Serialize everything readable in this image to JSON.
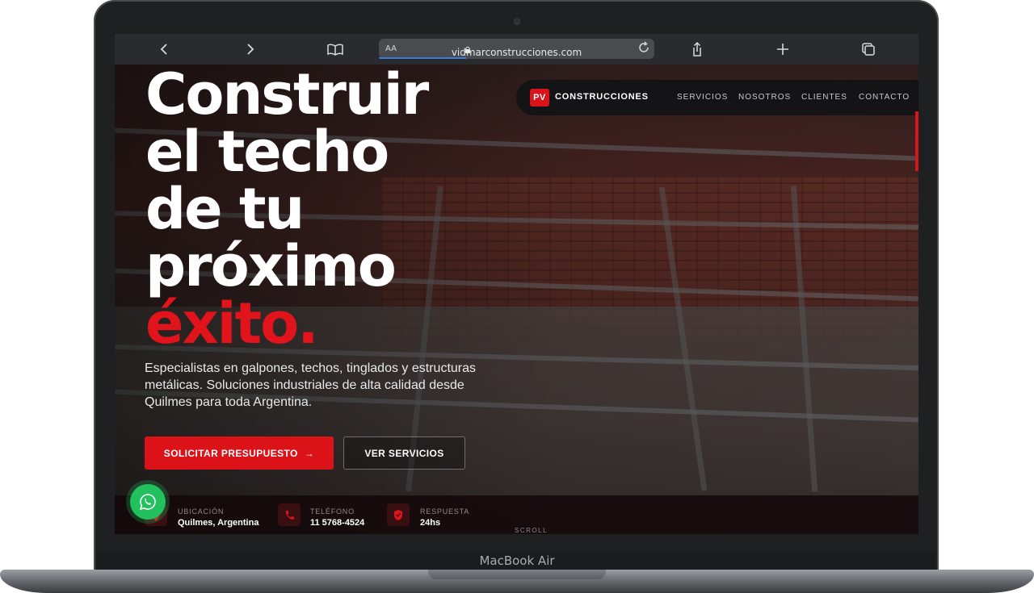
{
  "device": {
    "label": "MacBook Air"
  },
  "browser": {
    "url": "vidmarconstrucciones.com",
    "text_size_label": "AA",
    "back_icon": "chevron-left-icon",
    "forward_icon": "chevron-right-icon",
    "bookmarks_icon": "book-icon",
    "share_icon": "share-icon",
    "new_tab_icon": "plus-icon",
    "tabs_icon": "tabs-icon"
  },
  "nav": {
    "logo_badge": "PV",
    "logo_text": "CONSTRUCCIONES",
    "links": [
      "SERVICIOS",
      "NOSOTROS",
      "CLIENTES",
      "CONTACTO"
    ]
  },
  "hero": {
    "headline": [
      "Construir",
      "el techo",
      "de tu",
      "próximo",
      "éxito."
    ],
    "subtitle": "Especialistas en galpones, techos, tinglados y estructuras metálicas. Soluciones industriales de alta calidad desde Quilmes para toda Argentina.",
    "cta_primary": "SOLICITAR PRESUPUESTO",
    "cta_primary_arrow": "→",
    "cta_secondary": "VER SERVICIOS"
  },
  "info": [
    {
      "label": "UBICACIÓN",
      "value": "Quilmes, Argentina",
      "icon": "location-pin-icon"
    },
    {
      "label": "TELÉFONO",
      "value": "11 5768-4524",
      "icon": "phone-icon"
    },
    {
      "label": "RESPUESTA",
      "value": "24hs",
      "icon": "shield-icon"
    }
  ],
  "scroll_label": "SCROLL",
  "colors": {
    "accent": "#dc1219",
    "whatsapp": "#22c15e"
  }
}
